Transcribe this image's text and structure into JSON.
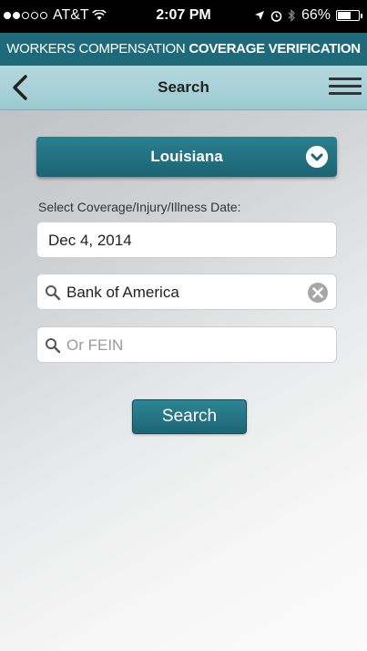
{
  "status_bar": {
    "carrier": "AT&T",
    "time": "2:07 PM",
    "battery": "66%",
    "battery_level": 0.66
  },
  "banner": {
    "prefix": "WORKERS COMPENSATION ",
    "emphasis": "COVERAGE VERIFICATION"
  },
  "navbar": {
    "title": "Search"
  },
  "form": {
    "state_value": "Louisiana",
    "date_label": "Select Coverage/Injury/Illness Date:",
    "date_value": "Dec 4, 2014",
    "employer_value": "Bank of America",
    "fein_placeholder": "Or FEIN",
    "search_button": "Search"
  },
  "colors": {
    "primary": "#1f6a7a",
    "navbar": "#a9d2d8"
  }
}
